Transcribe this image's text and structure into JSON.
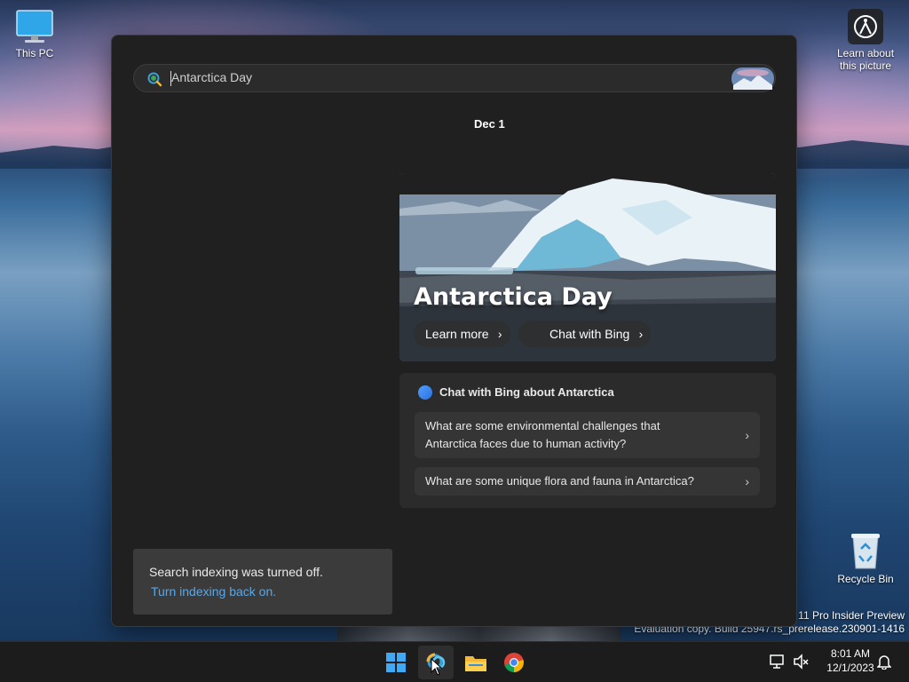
{
  "desktop": {
    "icons": [
      {
        "label": "This PC"
      },
      {
        "label": "Recycle Bin"
      }
    ],
    "spotlight": {
      "label_line1": "Learn about",
      "label_line2": "this picture"
    },
    "watermark": {
      "line1": "s 11 Pro Insider Preview",
      "line2": "Evaluation copy. Build 25947.rs_prerelease.230901-1416"
    }
  },
  "search": {
    "query": "Antarctica Day",
    "date": "Dec 1",
    "hero": {
      "title": "Antarctica Day",
      "buttons": [
        {
          "label": "Learn more"
        },
        {
          "label": "Chat with Bing"
        }
      ]
    },
    "chat": {
      "heading": "Chat with Bing about Antarctica",
      "questions": [
        {
          "line1": "What are some environmental challenges that",
          "line2": "Antarctica faces due to human activity?"
        },
        {
          "line1": "What are some unique flora and fauna in Antarctica?"
        }
      ]
    },
    "notice": {
      "message": "Search indexing was turned off.",
      "link": "Turn indexing back on."
    }
  },
  "taskbar": {
    "apps": [
      {
        "icon": "windows-start-icon"
      },
      {
        "icon": "search-app-icon"
      },
      {
        "icon": "file-explorer-icon"
      },
      {
        "icon": "chrome-icon"
      }
    ],
    "clock": {
      "time": "8:01 AM",
      "date": "12/1/2023"
    }
  },
  "colors": {
    "accent": "#58a8e8",
    "panel": "#202020",
    "taskbar": "#1c1c1c"
  }
}
